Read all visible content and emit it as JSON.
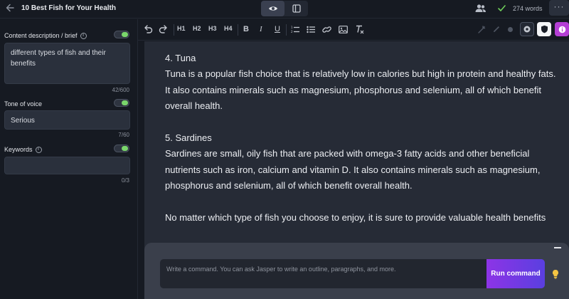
{
  "header": {
    "back_icon": "arrow-left-icon",
    "title": "10 Best Fish for Your Health",
    "view_modes": [
      {
        "icon": "eye-icon",
        "active": true
      },
      {
        "icon": "sidebar-layout-icon",
        "active": false
      }
    ],
    "collaborators_icon": "users-icon",
    "status_icon": "check-icon",
    "word_count": "274 words",
    "more_label": "···"
  },
  "sidebar": {
    "content_description": {
      "label": "Content description / brief",
      "value": "different types of fish and their benefits",
      "counter": "42/600",
      "enabled": true
    },
    "tone_of_voice": {
      "label": "Tone of voice",
      "value": "Serious",
      "counter": "7/60",
      "enabled": true
    },
    "keywords": {
      "label": "Keywords",
      "value": "",
      "counter": "0/3",
      "enabled": true
    }
  },
  "toolbar": {
    "undo_icon": "undo-icon",
    "redo_icon": "redo-icon",
    "headings": [
      "H1",
      "H2",
      "H3",
      "H4"
    ],
    "bold": "B",
    "italic": "I",
    "underline": "U",
    "icons": [
      "ordered-list-icon",
      "bullet-list-icon",
      "link-icon",
      "image-icon",
      "clear-format-icon"
    ],
    "right_icons": [
      "magic-icon",
      "pen-icon",
      "dot-icon",
      "settings-icon",
      "shield-icon",
      "badge-icon"
    ],
    "colors": {
      "accent_pink": "#b43fd4",
      "white": "#ffffff"
    }
  },
  "editor": {
    "paragraphs": [
      "4. Tuna",
      "Tuna is a popular fish choice that is relatively low in calories but high in protein and healthy fats. It also contains minerals such as magnesium, phosphorus and selenium, all of which benefit overall health.",
      "5. Sardines",
      "Sardines are small, oily fish that are packed with omega-3 fatty acids and other beneficial nutrients such as iron, calcium and vitamin D. It also contains minerals such as magnesium, phosphorus and selenium, all of which benefit overall health.",
      "No matter which type of fish you choose to enjoy, it is sure to provide valuable health benefits"
    ]
  },
  "command": {
    "placeholder": "Write a command. You can ask Jasper to write an outline, paragraphs, and more.",
    "run_label": "Run command",
    "run_gradient": [
      "#8d34e6",
      "#5a3fe0"
    ],
    "hint_icon": "lightbulb-icon"
  }
}
